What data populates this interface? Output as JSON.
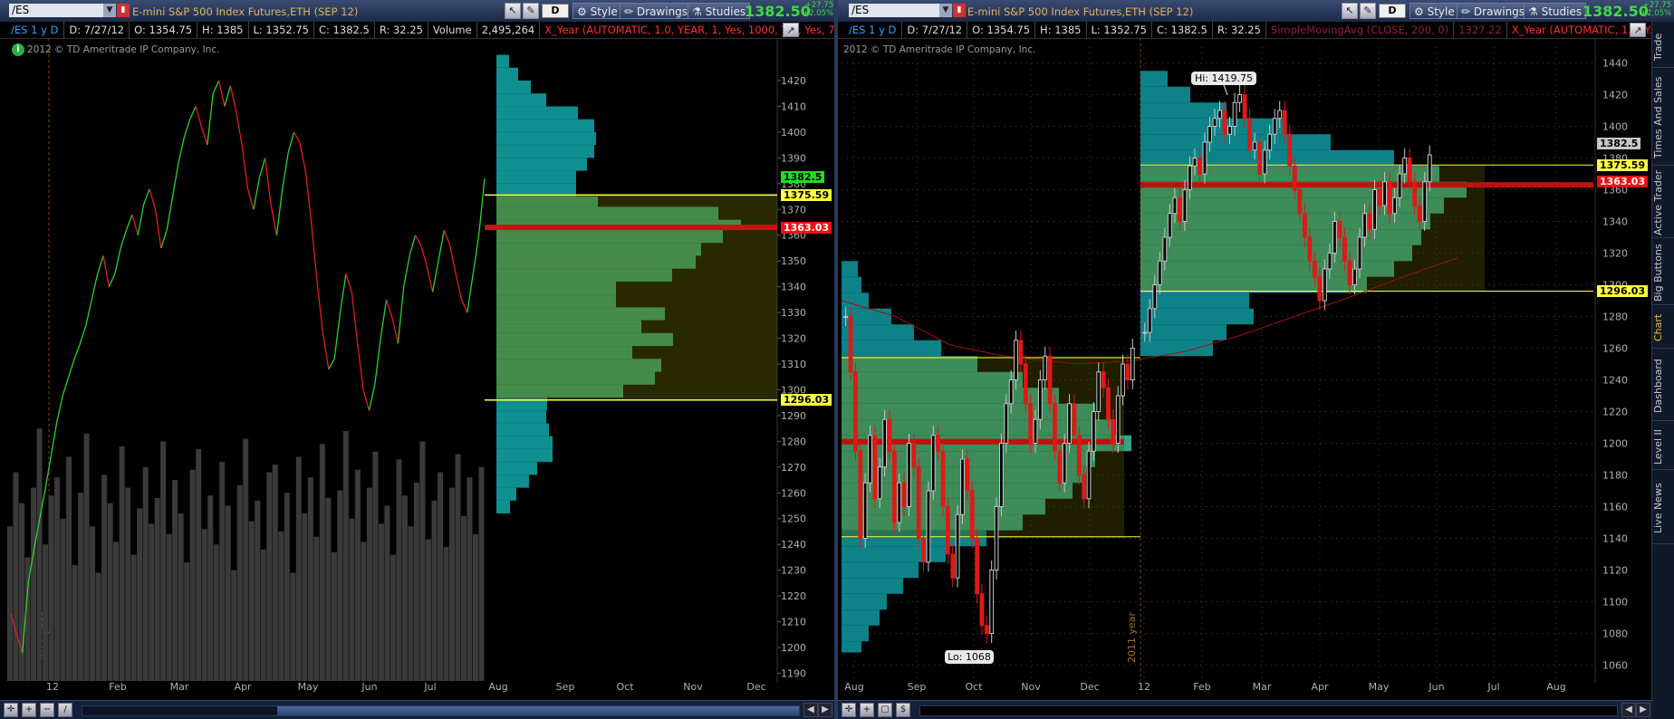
{
  "left": {
    "symbol": "/ES",
    "description": "E-mini S&P 500 Index Futures,ETH (SEP 12)",
    "toolbar": {
      "style": "Style",
      "drawings": "Drawings",
      "studies": "Studies",
      "d": "D"
    },
    "last_price": "1382.50",
    "change_abs": "+27.75",
    "change_pct": "+2.05%",
    "quote": {
      "symbol": "/ES 1 y D",
      "date": "D: 7/27/12",
      "open": "O: 1354.75",
      "high": "H: 1385",
      "low": "L: 1352.75",
      "close": "C: 1382.5",
      "range": "R: 32.25",
      "volume_label": "Volume",
      "volume": "2,495,264",
      "indicator": "X_Year (AUTOMATIC, 1.0, YEAR, 1, Yes, 1000, Yes, Yes, 7"
    },
    "copyright": "2012 © TD Ameritrade IP Company, Inc.",
    "info_icon": "info-icon",
    "year_marker": "2011 year",
    "tags": {
      "last": "1382.5",
      "vah": "1375.59",
      "poc": "1363.03",
      "val": "1296.03"
    },
    "colors": {
      "last": "#22dd22",
      "vah": "#ffff44",
      "poc": "#ee1111",
      "val": "#ffff44"
    },
    "chart_data": {
      "type": "line",
      "x_labels": [
        "12",
        "Feb",
        "Mar",
        "Apr",
        "May",
        "Jun",
        "Jul",
        "Aug",
        "Sep",
        "Oct",
        "Nov",
        "Dec"
      ],
      "y_ticks": [
        1190,
        1200,
        1210,
        1220,
        1230,
        1240,
        1250,
        1260,
        1270,
        1280,
        1290,
        1300,
        1310,
        1320,
        1330,
        1340,
        1350,
        1360,
        1370,
        1380,
        1390,
        1400,
        1410,
        1420
      ],
      "ylim": [
        1187,
        1433
      ],
      "price": [
        1213,
        1205,
        1198,
        1225,
        1238,
        1250,
        1262,
        1275,
        1288,
        1298,
        1305,
        1312,
        1318,
        1325,
        1335,
        1345,
        1352,
        1340,
        1345,
        1355,
        1362,
        1368,
        1360,
        1372,
        1378,
        1370,
        1355,
        1362,
        1375,
        1388,
        1398,
        1405,
        1410,
        1402,
        1395,
        1415,
        1420,
        1410,
        1418,
        1408,
        1395,
        1378,
        1370,
        1382,
        1390,
        1372,
        1360,
        1378,
        1392,
        1400,
        1396,
        1385,
        1365,
        1342,
        1322,
        1308,
        1312,
        1330,
        1345,
        1338,
        1318,
        1300,
        1292,
        1302,
        1320,
        1335,
        1328,
        1318,
        1340,
        1352,
        1360,
        1356,
        1348,
        1338,
        1350,
        1362,
        1356,
        1345,
        1335,
        1330,
        1345,
        1360,
        1382
      ],
      "volume_profile": [
        [
          1190,
          1195,
          0
        ],
        [
          1252,
          1257,
          15
        ],
        [
          1257,
          1262,
          22
        ],
        [
          1262,
          1267,
          36
        ],
        [
          1267,
          1272,
          45
        ],
        [
          1272,
          1277,
          62
        ],
        [
          1277,
          1282,
          62
        ],
        [
          1282,
          1287,
          58
        ],
        [
          1287,
          1292,
          55
        ],
        [
          1292,
          1297,
          56
        ],
        [
          1297,
          1302,
          140
        ],
        [
          1302,
          1307,
          175
        ],
        [
          1307,
          1312,
          182
        ],
        [
          1312,
          1317,
          150
        ],
        [
          1317,
          1322,
          195
        ],
        [
          1322,
          1327,
          160
        ],
        [
          1327,
          1332,
          186
        ],
        [
          1332,
          1337,
          132
        ],
        [
          1337,
          1342,
          132
        ],
        [
          1342,
          1347,
          194
        ],
        [
          1347,
          1352,
          220
        ],
        [
          1352,
          1357,
          226
        ],
        [
          1357,
          1362,
          250
        ],
        [
          1362,
          1366,
          270
        ],
        [
          1366,
          1371,
          245
        ],
        [
          1371,
          1375,
          112
        ],
        [
          1375,
          1380,
          88
        ],
        [
          1380,
          1385,
          88
        ],
        [
          1385,
          1390,
          100
        ],
        [
          1390,
          1395,
          108
        ],
        [
          1395,
          1400,
          110
        ],
        [
          1400,
          1405,
          108
        ],
        [
          1405,
          1410,
          90
        ],
        [
          1410,
          1415,
          55
        ],
        [
          1415,
          1420,
          38
        ],
        [
          1420,
          1425,
          24
        ],
        [
          1425,
          1430,
          14
        ]
      ],
      "volume_bars": [
        1247,
        1268,
        1256,
        1235,
        1262,
        1285,
        1240,
        1259,
        1266,
        1250,
        1274,
        1232,
        1260,
        1283,
        1247,
        1229,
        1267,
        1256,
        1241,
        1278,
        1262,
        1236,
        1254,
        1270,
        1248,
        1258,
        1280,
        1244,
        1265,
        1252,
        1233,
        1269,
        1277,
        1246,
        1259,
        1240,
        1272,
        1255,
        1230,
        1263,
        1281,
        1249,
        1257,
        1238,
        1268,
        1271,
        1245,
        1260,
        1229,
        1274,
        1252,
        1266,
        1243,
        1279,
        1258,
        1237,
        1261,
        1284,
        1250,
        1269,
        1241,
        1262,
        1276,
        1248,
        1255,
        1236,
        1273,
        1259,
        1247,
        1264,
        1280,
        1242,
        1257,
        1268,
        1239,
        1262,
        1275,
        1251,
        1266,
        1244,
        1270
      ]
    }
  },
  "right": {
    "symbol": "/ES",
    "description": "E-mini S&P 500 Index Futures,ETH (SEP 12)",
    "toolbar": {
      "style": "Style",
      "drawings": "Drawings",
      "studies": "Studies",
      "d": "D"
    },
    "last_price": "1382.50",
    "change_abs": "+27.75",
    "change_pct": "+2.05%",
    "quote": {
      "symbol": "/ES 1 y D",
      "date": "D: 7/27/12",
      "open": "O: 1354.75",
      "high": "H: 1385",
      "low": "L: 1352.75",
      "close": "C: 1382.5",
      "range": "R: 32.25",
      "sma": "SimpleMovingAvg (CLOSE, 200, 0)",
      "sma_value": "1327.22",
      "indicator": "X_Year (AUTOMATIC, 1.0, Y..."
    },
    "copyright": "2012 © TD Ameritrade IP Company, Inc.",
    "year_marker": "2011 year",
    "hi_label": "Hi: 1419.75",
    "lo_label": "Lo: 1068",
    "tags": {
      "last": "1382.5",
      "vah": "1375.59",
      "poc": "1363.03",
      "val": "1296.03"
    },
    "colors": {
      "last": "#c8c8c8",
      "vah": "#ffff44",
      "poc": "#ee1111",
      "val": "#ffff44"
    },
    "sidebar": [
      "Trade",
      "Times And Sales",
      "Active Trader",
      "Big Buttons",
      "Chart",
      "Dashboard",
      "Level II",
      "Live News"
    ],
    "chart_data": {
      "type": "candlestick",
      "x_labels": [
        "Aug",
        "Sep",
        "Oct",
        "Nov",
        "Dec",
        "12",
        "Feb",
        "Mar",
        "Apr",
        "May",
        "Jun",
        "Jul",
        "Aug"
      ],
      "y_ticks": [
        1060,
        1080,
        1100,
        1120,
        1140,
        1160,
        1180,
        1200,
        1220,
        1240,
        1260,
        1280,
        1300,
        1320,
        1340,
        1360,
        1380,
        1400,
        1420,
        1440
      ],
      "ylim": [
        1050,
        1450
      ],
      "closes_2011": [
        1280,
        1245,
        1195,
        1140,
        1175,
        1205,
        1165,
        1185,
        1215,
        1195,
        1150,
        1175,
        1160,
        1200,
        1185,
        1140,
        1125,
        1170,
        1205,
        1195,
        1160,
        1130,
        1115,
        1155,
        1190,
        1170,
        1140,
        1105,
        1085,
        1080,
        1120,
        1160,
        1200,
        1225,
        1240,
        1265,
        1250,
        1225,
        1200,
        1215,
        1240,
        1255,
        1225,
        1195,
        1175,
        1200,
        1225,
        1205,
        1180,
        1165,
        1195,
        1220,
        1245,
        1235,
        1215,
        1200,
        1230,
        1250,
        1240,
        1260
      ],
      "closes_2012": [
        1270,
        1285,
        1300,
        1315,
        1330,
        1345,
        1355,
        1340,
        1360,
        1375,
        1380,
        1370,
        1390,
        1400,
        1405,
        1410,
        1395,
        1400,
        1415,
        1420,
        1405,
        1385,
        1390,
        1370,
        1385,
        1395,
        1405,
        1410,
        1395,
        1375,
        1360,
        1345,
        1330,
        1315,
        1305,
        1290,
        1310,
        1320,
        1340,
        1330,
        1315,
        1300,
        1310,
        1330,
        1345,
        1335,
        1360,
        1350,
        1365,
        1345,
        1355,
        1370,
        1380,
        1365,
        1350,
        1340,
        1365,
        1382
      ],
      "sma_points": [
        [
          0,
          1290
        ],
        [
          60,
          1280
        ],
        [
          120,
          1262
        ],
        [
          180,
          1255
        ],
        [
          260,
          1250
        ],
        [
          320,
          1252
        ],
        [
          380,
          1258
        ],
        [
          440,
          1268
        ],
        [
          500,
          1280
        ],
        [
          560,
          1292
        ],
        [
          620,
          1305
        ],
        [
          680,
          1317
        ]
      ]
    }
  }
}
